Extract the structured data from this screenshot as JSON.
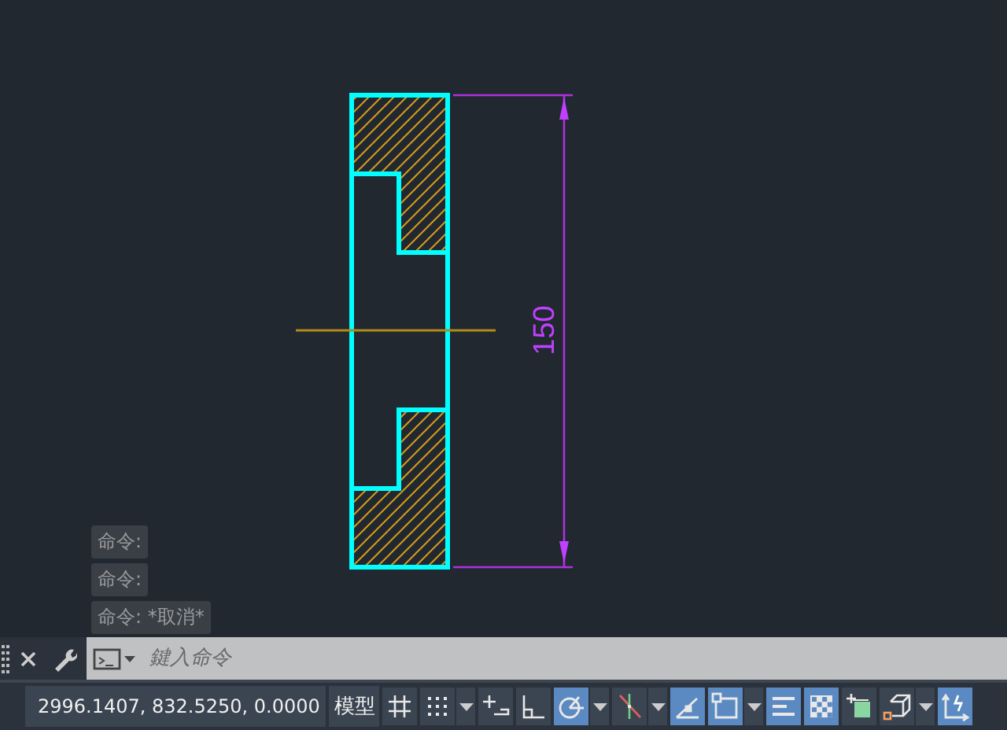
{
  "drawing": {
    "dimension_text": "150"
  },
  "command_history": [
    "命令:",
    "命令:",
    "命令: *取消*"
  ],
  "command_line": {
    "placeholder": "鍵入命令"
  },
  "status_bar": {
    "coordinates": "2996.1407, 832.5250, 0.0000",
    "space": "模型",
    "toggles": [
      {
        "kind": "grid",
        "on": false,
        "has_menu": false
      },
      {
        "kind": "snap",
        "on": false,
        "has_menu": true
      },
      {
        "kind": "infer",
        "on": false,
        "has_menu": false
      },
      {
        "kind": "ortho",
        "on": false,
        "has_menu": false
      },
      {
        "kind": "polar",
        "on": true,
        "has_menu": true
      },
      {
        "kind": "isodraft",
        "on": false,
        "has_menu": true
      },
      {
        "kind": "otrack",
        "on": true,
        "has_menu": false
      },
      {
        "kind": "osnap",
        "on": true,
        "has_menu": true
      },
      {
        "kind": "lineweight",
        "on": true,
        "has_menu": false
      },
      {
        "kind": "transparency",
        "on": true,
        "has_menu": false
      },
      {
        "kind": "selcycle",
        "on": false,
        "has_menu": false
      },
      {
        "kind": "osnap3d",
        "on": false,
        "has_menu": true
      },
      {
        "kind": "ucs",
        "on": true,
        "has_menu": false
      }
    ]
  }
}
